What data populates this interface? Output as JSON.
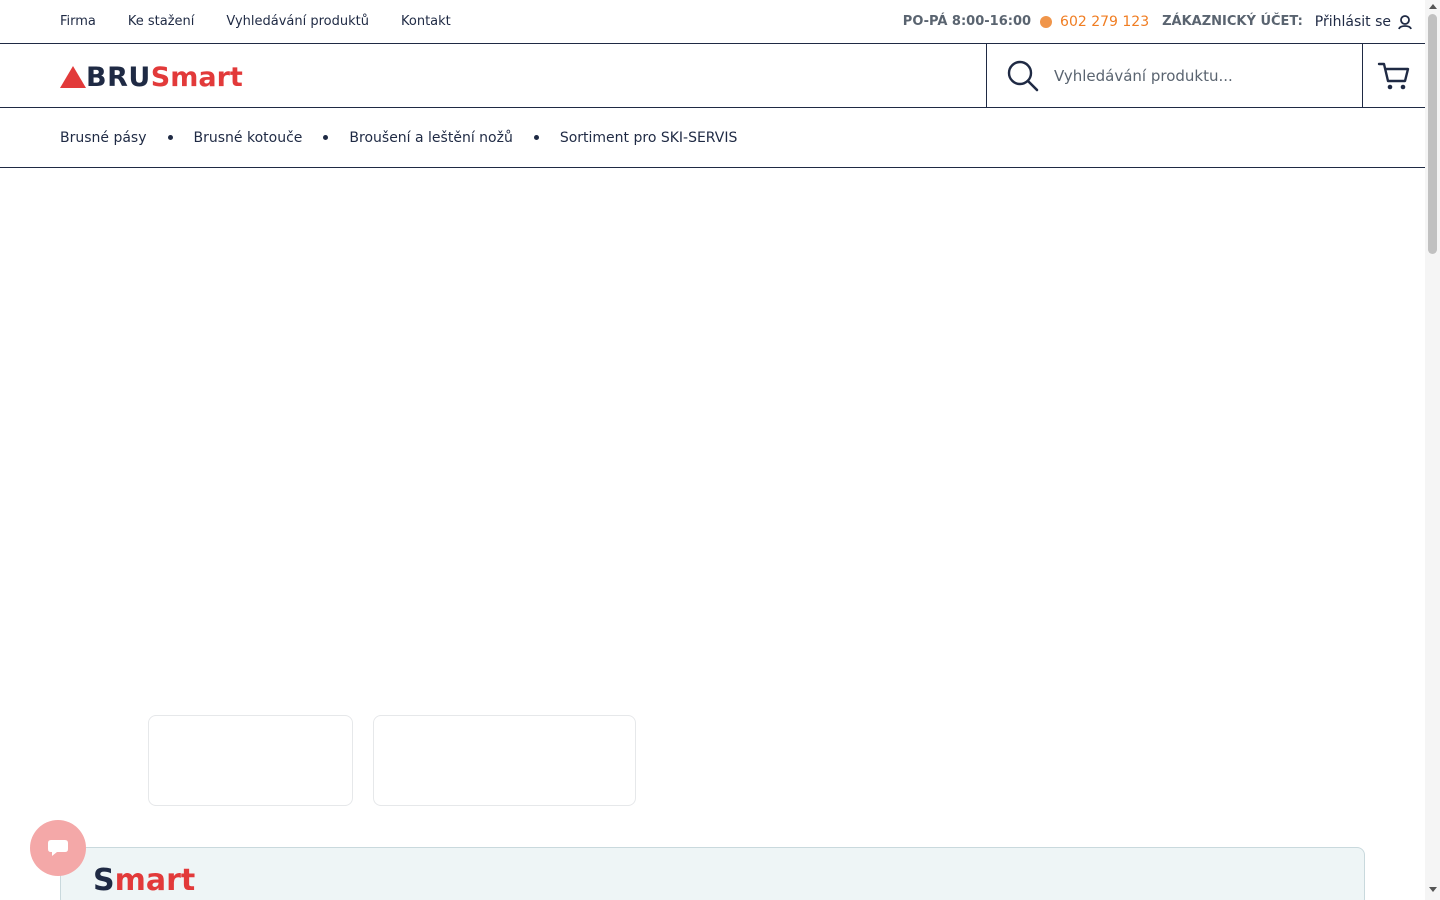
{
  "topbar": {
    "nav": [
      "Firma",
      "Ke stažení",
      "Vyhledávání produktů",
      "Kontakt"
    ],
    "hours": "PO-PÁ 8:00-16:00",
    "phone": "602 279 123",
    "account_label": "ZÁKAZNICKÝ ÚČET:",
    "login_label": "Přihlásit se"
  },
  "header": {
    "logo_part1": "BRU",
    "logo_part2": "Smart",
    "search_placeholder": "Vyhledávání produktu..."
  },
  "categories": [
    "Brusné pásy",
    "Brusné kotouče",
    "Broušení a leštění nožů",
    "Sortiment pro SKI-SERVIS"
  ],
  "panel": {
    "logo_first": "S",
    "logo_rest": "mart"
  },
  "colors": {
    "brand_navy": "#1f2a44",
    "brand_red": "#e23a3a",
    "accent_orange": "#f07d22"
  },
  "icons": {
    "user": "user-icon",
    "search": "search-icon",
    "cart": "cart-icon",
    "chat": "chat-icon"
  }
}
